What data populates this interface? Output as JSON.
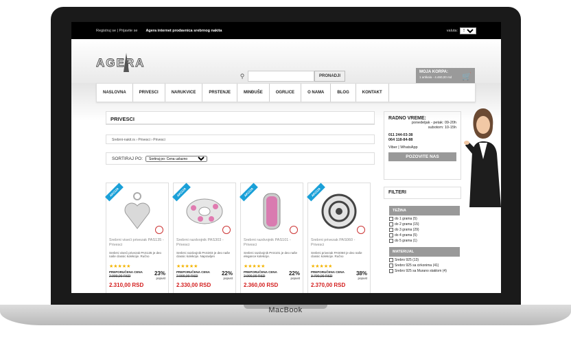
{
  "device": {
    "brand": "MacBook"
  },
  "topbar": {
    "register_login": "Registruj se | Prijavite se",
    "tagline": "Agera internet prodavnica srebrnog nakita",
    "currency_label": "valuta:",
    "currency_value": "SSD"
  },
  "header": {
    "logo_text": "AGERA",
    "search_button": "PRONADJI",
    "search_placeholder": "",
    "cart_title": "MOJA KORPA:",
    "cart_summary": "1 artikala - 4.460,00 rsd"
  },
  "nav": [
    "NASLOVNA",
    "PRIVESCI",
    "NARUKVICE",
    "PRSTENJE",
    "MINĐUŠE",
    "OGRLICE",
    "O NAMA",
    "BLOG",
    "KONTAKT"
  ],
  "main": {
    "title": "PRIVESCI",
    "breadcrumb": "Srebrni-nakit.rs › Privesci › Privesci",
    "sort_label": "SORTIRAJ PO:",
    "sort_value": "Sortiraj po: Cena uzlazno"
  },
  "products": [
    {
      "badge": "AKCIJA",
      "name": "Srebrni viseći privezak PAS135 - Privesci",
      "desc": "Srebrni viseći privezak PAS135 je deo naše classic kolekcije. Ručno",
      "price_label": "PREPORUČENA CENA",
      "old_price": "2.990,00 RSD",
      "discount": "23%",
      "discount_label": "popust",
      "price": "2.310,00 RSD"
    },
    {
      "badge": "AKCIJA",
      "name": "Srebrni razdvojnik PAS303 - Privesci",
      "desc": "Srebrni razdvojnik PAS303 je deo naše classic kolekcije. Napravljen",
      "price_label": "PREPORUČENA CENA",
      "old_price": "2.990,00 RSD",
      "discount": "22%",
      "discount_label": "popust",
      "price": "2.330,00 RSD"
    },
    {
      "badge": "AKCIJA",
      "name": "Srebrni razdvojnik PAS101 - Privesci",
      "desc": "Srebrni razdvojnik PAS101 je deo naše elegance kolekcije.",
      "price_label": "PREPORUČENA CENA",
      "old_price": "2.990,00 RSD",
      "discount": "22%",
      "discount_label": "popust",
      "price": "2.360,00 RSD"
    },
    {
      "badge": "AKCIJA",
      "name": "Srebrni privezak PAS060 - Privesci",
      "desc": "Srebrni privezak PAS060 je deo naše classic kolekcije. Ručno",
      "price_label": "PREPORUČENA CENA",
      "old_price": "3.790,00 RSD",
      "discount": "38%",
      "discount_label": "popust",
      "price": "2.370,00 RSD"
    }
  ],
  "sidebar": {
    "hours_title": "RADNO VREME:",
    "hours_lines": [
      "ponedeljak - petak: 09-20h",
      "subotom: 10-15h"
    ],
    "phones": [
      "011 244-03-38",
      "064 118-84-88"
    ],
    "viber": "Viber | WhatsApp",
    "call_button": "POZOVITE NAS",
    "filters_title": "FILTERI",
    "weight_title": "TEŽINA",
    "weight_items": [
      "do 1 grama (5)",
      "do 2 grama (15)",
      "do 3 grama (29)",
      "do 4 grama (5)",
      "do 5 grama (1)"
    ],
    "material_title": "MATERIJAL",
    "material_items": [
      "Srebro 925 (13)",
      "Srebro 925 sa cirkonima (41)",
      "Srebro 925 sa Murano staklom (4)"
    ]
  },
  "colors": {
    "accent": "#1aa0d8",
    "price": "#d31d1d",
    "star": "#f4b400"
  }
}
